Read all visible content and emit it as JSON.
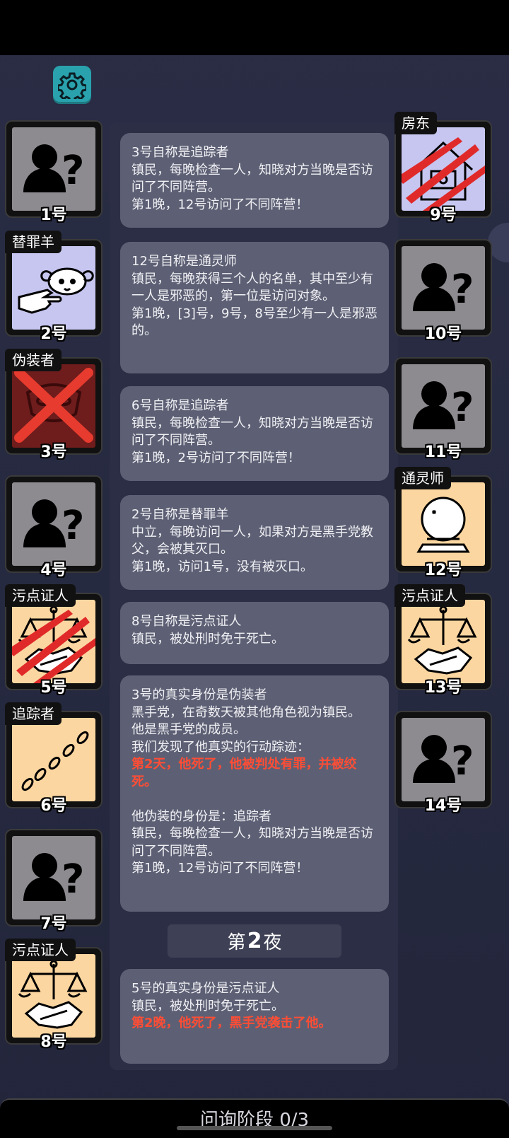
{
  "settings": {
    "icon": "gear-icon"
  },
  "left_players": [
    {
      "number": "1号",
      "role": "",
      "bg": "gray",
      "icon": "unknown-person-icon",
      "mark": ""
    },
    {
      "number": "2号",
      "role": "替罪羊",
      "bg": "lav",
      "icon": "sheep-icon",
      "mark": ""
    },
    {
      "number": "3号",
      "role": "伪装者",
      "bg": "darkred",
      "icon": "mask-icon",
      "mark": "cross"
    },
    {
      "number": "4号",
      "role": "",
      "bg": "gray",
      "icon": "unknown-person-icon",
      "mark": ""
    },
    {
      "number": "5号",
      "role": "污点证人",
      "bg": "peach",
      "icon": "scales-icon",
      "mark": "claw"
    },
    {
      "number": "6号",
      "role": "追踪者",
      "bg": "peach",
      "icon": "footprints-icon",
      "mark": ""
    },
    {
      "number": "7号",
      "role": "",
      "bg": "gray",
      "icon": "unknown-person-icon",
      "mark": ""
    },
    {
      "number": "8号",
      "role": "污点证人",
      "bg": "peach",
      "icon": "scales-icon",
      "mark": ""
    }
  ],
  "right_players": [
    {
      "number": "9号",
      "role": "房东",
      "bg": "lav",
      "icon": "house-icon",
      "mark": "claw"
    },
    {
      "number": "10号",
      "role": "",
      "bg": "gray",
      "icon": "unknown-person-icon",
      "mark": ""
    },
    {
      "number": "11号",
      "role": "",
      "bg": "gray",
      "icon": "unknown-person-icon",
      "mark": ""
    },
    {
      "number": "12号",
      "role": "通灵师",
      "bg": "peach",
      "icon": "crystal-ball-icon",
      "mark": ""
    },
    {
      "number": "13号",
      "role": "污点证人",
      "bg": "peach",
      "icon": "scales-icon",
      "mark": ""
    },
    {
      "number": "14号",
      "role": "",
      "bg": "gray",
      "icon": "unknown-person-icon",
      "mark": ""
    }
  ],
  "log": [
    {
      "lines": [
        {
          "t": "3号自称是追踪者"
        },
        {
          "t": "镇民，每晚检查一人，知晓对方当晚是否访问了不同阵营。"
        },
        {
          "t": "第1晚，12号访问了不同阵营！"
        }
      ]
    },
    {
      "lines": [
        {
          "t": "12号自称是通灵师"
        },
        {
          "t": "镇民，每晚获得三个人的名单，其中至少有一人是邪恶的，第一位是访问对象。"
        },
        {
          "t": "第1晚，[3]号，9号，8号至少有一人是邪恶的。"
        }
      ]
    },
    {
      "lines": [
        {
          "t": "6号自称是追踪者"
        },
        {
          "t": "镇民，每晚检查一人，知晓对方当晚是否访问了不同阵营。"
        },
        {
          "t": "第1晚，2号访问了不同阵营！"
        }
      ]
    },
    {
      "lines": [
        {
          "t": "2号自称是替罪羊"
        },
        {
          "t": "中立，每晚访问一人，如果对方是黑手党教父，会被其灭口。"
        },
        {
          "t": "第1晚，访问1号，没有被灭口。"
        }
      ]
    },
    {
      "lines": [
        {
          "t": "8号自称是污点证人"
        },
        {
          "t": "镇民，被处刑时免于死亡。"
        }
      ]
    },
    {
      "lines": [
        {
          "t": "3号的真实身份是伪装者"
        },
        {
          "t": "黑手党，在奇数天被其他角色视为镇民。"
        },
        {
          "t": "他是黑手党的成员。"
        },
        {
          "t": "我们发现了他真实的行动踪迹："
        },
        {
          "t": "第2天，他死了，他被判处有罪，并被绞死。",
          "red": true
        },
        {
          "t": " "
        },
        {
          "t": "他伪装的身份是：追踪者"
        },
        {
          "t": "镇民，每晚检查一人，知晓对方当晚是否访问了不同阵营。"
        },
        {
          "t": "第1晚，12号访问了不同阵营！"
        }
      ]
    },
    {
      "lines": [
        {
          "t": "5号的真实身份是污点证人"
        },
        {
          "t": "镇民，被处刑时免于死亡。"
        },
        {
          "t": "第2晚，他死了，黑手党袭击了他。",
          "red": true
        }
      ]
    }
  ],
  "night": {
    "prefix": "第",
    "number": "2",
    "suffix": "夜"
  },
  "phase": "问询阶段 0/3"
}
